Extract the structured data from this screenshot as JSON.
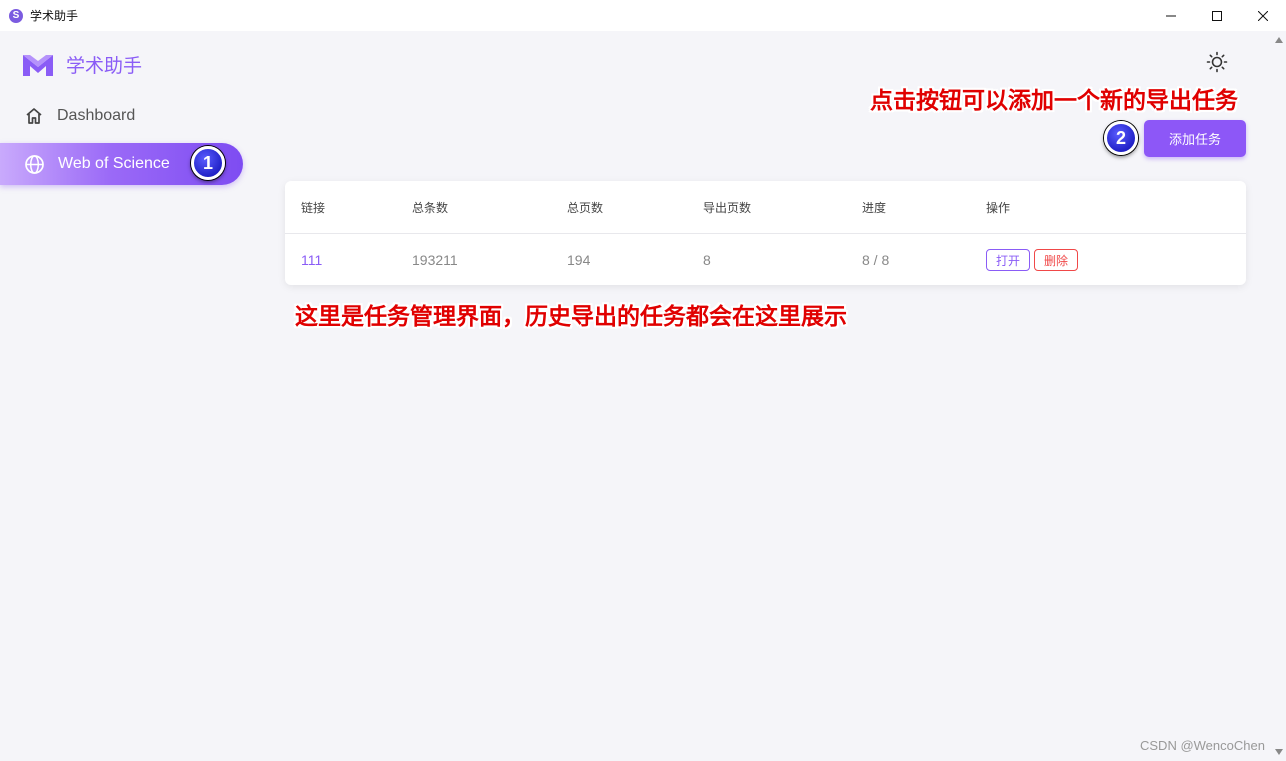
{
  "window": {
    "title": "学术助手",
    "app_icon_letter": "S",
    "controls": [
      "minimize",
      "maximize",
      "close"
    ]
  },
  "sidebar": {
    "brand": {
      "logo": "m-logo-icon",
      "name": "学术助手"
    },
    "items": [
      {
        "label": "Dashboard",
        "icon": "home-icon",
        "active": false
      },
      {
        "label": "Web of Science",
        "icon": "globe-icon",
        "active": true
      }
    ]
  },
  "header": {
    "theme_icon": "sun-icon"
  },
  "annotations": {
    "marker_1": "1",
    "marker_2": "2",
    "note_add": "点击按钮可以添加一个新的导出任务",
    "note_table": "这里是任务管理界面，历史导出的任务都会在这里展示"
  },
  "toolbar": {
    "add_task_label": "添加任务"
  },
  "table": {
    "columns": [
      "链接",
      "总条数",
      "总页数",
      "导出页数",
      "进度",
      "操作"
    ],
    "rows": [
      {
        "link": "111",
        "total_items": "193211",
        "total_pages": "194",
        "export_pages": "8",
        "progress": "8 / 8",
        "actions": {
          "open": "打开",
          "delete": "删除"
        }
      }
    ]
  },
  "watermark": "CSDN @WencoChen",
  "colors": {
    "accent": "#8d57f7",
    "danger": "#f04848",
    "annotation": "#e00000",
    "marker": "#1010c0"
  }
}
